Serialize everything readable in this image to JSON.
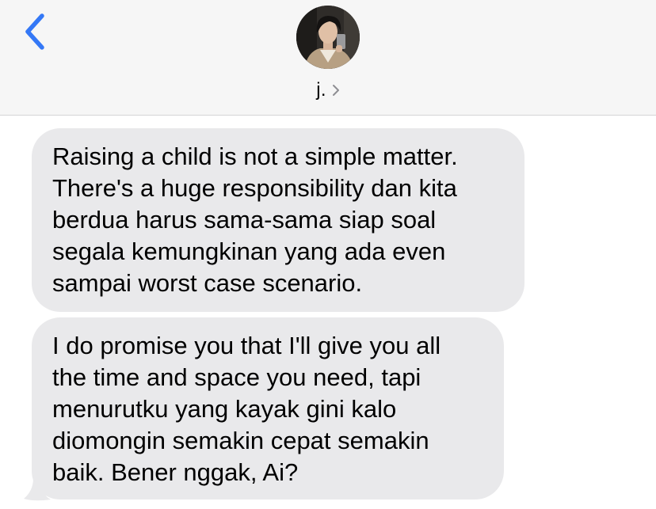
{
  "header": {
    "back_icon": "chevron-left-icon",
    "contact_name": "j.",
    "disclosure_icon": "chevron-right-icon",
    "accent_color": "#3478f6"
  },
  "messages": [
    {
      "direction": "incoming",
      "text": "Raising a child is not a simple matter.\nThere's a huge responsibility dan kita\nberdua harus sama-sama siap soal\nsegala kemungkinan yang ada even\nsampai worst case scenario."
    },
    {
      "direction": "incoming",
      "text": "I do promise you that I'll give you all\nthe time and space you need, tapi\nmenurutku yang kayak gini kalo\ndiomongin semakin cepat semakin\nbaik. Bener nggak, Ai?"
    }
  ],
  "colors": {
    "header_bg": "#f6f6f6",
    "incoming_bubble": "#e9e9eb",
    "text": "#000000"
  }
}
